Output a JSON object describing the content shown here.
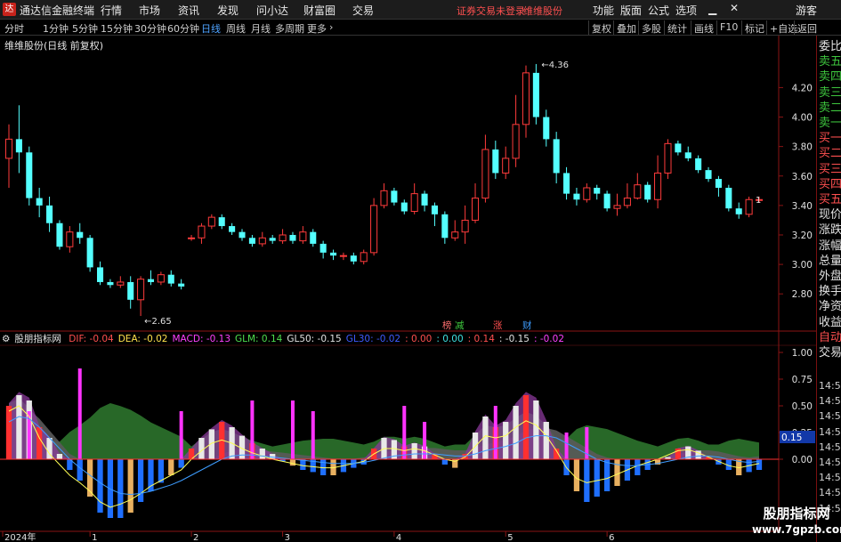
{
  "titlebar": {
    "app_name": "通达信金融终端",
    "menu": [
      "行情",
      "市场",
      "资讯",
      "发现",
      "问小达",
      "财富圈",
      "交易"
    ],
    "status": "证券交易未登录",
    "stock_name": "维维股份",
    "right_menu": [
      "功能",
      "版面",
      "公式",
      "选项"
    ],
    "guest": "游客"
  },
  "periodbar": {
    "items": [
      "分时",
      "1分钟",
      "5分钟",
      "15分钟",
      "30分钟",
      "60分钟",
      "日线",
      "周线",
      "月线",
      "多周期",
      "更多"
    ],
    "active": "日线",
    "right_items": [
      "复权",
      "叠加",
      "多股",
      "统计",
      "画线",
      "F10",
      "标记",
      "+自选",
      "返回"
    ]
  },
  "main_chart": {
    "title": "维维股份(日线 前复权)",
    "high_label": "4.36",
    "low_label": "2.65",
    "last_label": "1",
    "y_labels": [
      "4.20",
      "4.00",
      "3.80",
      "3.60",
      "3.40",
      "3.20",
      "3.00",
      "2.80"
    ],
    "event_tags": [
      "榜",
      "减",
      "涨",
      "财"
    ]
  },
  "indicator": {
    "name": "股朋指标网",
    "items": [
      {
        "text": "DIF: -0.04",
        "color": "#ff4f4f"
      },
      {
        "text": "DEA: -0.02",
        "color": "#ffe14d"
      },
      {
        "text": "MACD: -0.13",
        "color": "#ff40ff"
      },
      {
        "text": "GLM: 0.14",
        "color": "#4ede4e"
      },
      {
        "text": "GL50: -0.15",
        "color": "#e0e0e0"
      },
      {
        "text": "GL30: -0.02",
        "color": "#3e5bff"
      },
      {
        "text": ": 0.00",
        "color": "#ff4f4f"
      },
      {
        "text": ": 0.00",
        "color": "#3ee0e0"
      },
      {
        "text": ": 0.14",
        "color": "#ff4f4f"
      },
      {
        "text": ": -0.15",
        "color": "#e0e0e0"
      },
      {
        "text": ": -0.02",
        "color": "#ff40ff"
      }
    ],
    "y_labels": [
      "1.00",
      "0.75",
      "0.50",
      "0.25",
      "0.00"
    ],
    "current_value": "0.15"
  },
  "x_axis": {
    "labels": [
      "2024年",
      "1",
      "2",
      "3",
      "4",
      "5",
      "6"
    ]
  },
  "side_panel": {
    "items": [
      "委比",
      "卖五",
      "卖四",
      "卖三",
      "卖二",
      "卖一",
      "买一",
      "买二",
      "买三",
      "买四",
      "买五",
      "现价",
      "涨跌",
      "涨幅",
      "总量",
      "外盘",
      "换手",
      "净资",
      "收益",
      "自动",
      "交易"
    ],
    "times": [
      "14:56",
      "14:56",
      "14:56",
      "14:56",
      "14:56",
      "14:56",
      "14:56",
      "14:56",
      "14:56"
    ]
  },
  "watermark": {
    "line1": "股朋指标网",
    "line2": "www.7gpzb.com"
  },
  "chart_data": {
    "type": "candlestick",
    "ylim": [
      2.62,
      4.42
    ],
    "x_month_starts": {
      "1": 8,
      "2": 18,
      "3": 27,
      "4": 38,
      "5": 49,
      "6": 59
    },
    "candles": [
      [
        3.72,
        3.85,
        3.95,
        3.52
      ],
      [
        3.85,
        3.76,
        4.08,
        3.62
      ],
      [
        3.76,
        3.45,
        3.8,
        3.4
      ],
      [
        3.45,
        3.4,
        3.52,
        3.32
      ],
      [
        3.4,
        3.28,
        3.46,
        3.22
      ],
      [
        3.28,
        3.12,
        3.3,
        3.1
      ],
      [
        3.12,
        3.22,
        3.26,
        3.08
      ],
      [
        3.22,
        3.18,
        3.28,
        3.14
      ],
      [
        3.18,
        2.98,
        3.2,
        2.95
      ],
      [
        2.98,
        2.88,
        3.02,
        2.86
      ],
      [
        2.88,
        2.86,
        2.9,
        2.84
      ],
      [
        2.86,
        2.88,
        2.92,
        2.84
      ],
      [
        2.88,
        2.76,
        2.92,
        2.7
      ],
      [
        2.76,
        2.9,
        2.92,
        2.65
      ],
      [
        2.9,
        2.88,
        2.96,
        2.86
      ],
      [
        2.88,
        2.93,
        2.95,
        2.86
      ],
      [
        2.93,
        2.87,
        2.96,
        2.85
      ],
      [
        2.87,
        2.85,
        2.9,
        2.83
      ],
      [
        3.18,
        3.18,
        3.2,
        3.16
      ],
      [
        3.18,
        3.26,
        3.28,
        3.14
      ],
      [
        3.26,
        3.32,
        3.34,
        3.24
      ],
      [
        3.32,
        3.26,
        3.34,
        3.24
      ],
      [
        3.26,
        3.22,
        3.28,
        3.2
      ],
      [
        3.22,
        3.18,
        3.24,
        3.16
      ],
      [
        3.18,
        3.14,
        3.2,
        3.12
      ],
      [
        3.14,
        3.18,
        3.22,
        3.12
      ],
      [
        3.18,
        3.16,
        3.2,
        3.14
      ],
      [
        3.16,
        3.2,
        3.24,
        3.14
      ],
      [
        3.2,
        3.16,
        3.22,
        3.14
      ],
      [
        3.16,
        3.22,
        3.26,
        3.14
      ],
      [
        3.22,
        3.14,
        3.24,
        3.12
      ],
      [
        3.14,
        3.08,
        3.16,
        3.04
      ],
      [
        3.08,
        3.06,
        3.1,
        3.03
      ],
      [
        3.06,
        3.06,
        3.08,
        3.03
      ],
      [
        3.06,
        3.02,
        3.08,
        3.0
      ],
      [
        3.02,
        3.08,
        3.1,
        3.0
      ],
      [
        3.08,
        3.4,
        3.45,
        3.06
      ],
      [
        3.4,
        3.5,
        3.55,
        3.38
      ],
      [
        3.5,
        3.42,
        3.52,
        3.4
      ],
      [
        3.42,
        3.36,
        3.44,
        3.34
      ],
      [
        3.36,
        3.48,
        3.55,
        3.34
      ],
      [
        3.48,
        3.4,
        3.5,
        3.36
      ],
      [
        3.4,
        3.34,
        3.42,
        3.26
      ],
      [
        3.34,
        3.18,
        3.36,
        3.14
      ],
      [
        3.18,
        3.22,
        3.3,
        3.16
      ],
      [
        3.22,
        3.3,
        3.4,
        3.14
      ],
      [
        3.3,
        3.45,
        3.55,
        3.28
      ],
      [
        3.45,
        3.78,
        3.88,
        3.42
      ],
      [
        3.78,
        3.62,
        3.84,
        3.58
      ],
      [
        3.62,
        3.72,
        3.8,
        3.58
      ],
      [
        3.72,
        3.95,
        4.15,
        3.66
      ],
      [
        3.95,
        4.3,
        4.35,
        3.86
      ],
      [
        4.3,
        4.0,
        4.36,
        3.95
      ],
      [
        4.0,
        3.85,
        4.05,
        3.8
      ],
      [
        3.85,
        3.62,
        3.9,
        3.55
      ],
      [
        3.62,
        3.48,
        3.66,
        3.44
      ],
      [
        3.48,
        3.44,
        3.52,
        3.4
      ],
      [
        3.44,
        3.52,
        3.55,
        3.42
      ],
      [
        3.52,
        3.48,
        3.54,
        3.44
      ],
      [
        3.48,
        3.38,
        3.5,
        3.36
      ],
      [
        3.38,
        3.4,
        3.48,
        3.33
      ],
      [
        3.4,
        3.45,
        3.55,
        3.38
      ],
      [
        3.45,
        3.54,
        3.62,
        3.44
      ],
      [
        3.54,
        3.44,
        3.56,
        3.42
      ],
      [
        3.44,
        3.62,
        3.74,
        3.38
      ],
      [
        3.62,
        3.82,
        3.85,
        3.58
      ],
      [
        3.82,
        3.76,
        3.84,
        3.74
      ],
      [
        3.76,
        3.72,
        3.8,
        3.7
      ],
      [
        3.72,
        3.64,
        3.74,
        3.62
      ],
      [
        3.64,
        3.58,
        3.66,
        3.56
      ],
      [
        3.58,
        3.52,
        3.6,
        3.46
      ],
      [
        3.52,
        3.38,
        3.54,
        3.36
      ],
      [
        3.38,
        3.34,
        3.42,
        3.31
      ],
      [
        3.34,
        3.44,
        3.46,
        3.32
      ],
      [
        3.44,
        3.44,
        3.46,
        3.42
      ]
    ],
    "macd": [
      0.5,
      0.6,
      0.55,
      0.3,
      0.2,
      0.05,
      -0.1,
      -0.2,
      -0.35,
      -0.5,
      -0.55,
      -0.55,
      -0.5,
      -0.4,
      -0.3,
      -0.22,
      -0.15,
      -0.08,
      0.1,
      0.2,
      0.28,
      0.35,
      0.3,
      0.22,
      0.15,
      0.1,
      0.05,
      -0.02,
      -0.06,
      -0.1,
      -0.12,
      -0.15,
      -0.15,
      -0.12,
      -0.08,
      -0.05,
      0.1,
      0.2,
      0.18,
      0.12,
      0.15,
      0.12,
      0.05,
      -0.05,
      -0.08,
      0.05,
      0.25,
      0.4,
      0.3,
      0.35,
      0.5,
      0.6,
      0.55,
      0.35,
      0.1,
      -0.15,
      -0.3,
      -0.4,
      -0.35,
      -0.3,
      -0.25,
      -0.2,
      -0.15,
      -0.1,
      -0.05,
      0.02,
      0.1,
      0.12,
      0.08,
      0.02,
      -0.05,
      -0.1,
      -0.15,
      -0.12,
      -0.1
    ],
    "dif": [
      0.45,
      0.5,
      0.4,
      0.2,
      0.05,
      -0.05,
      -0.15,
      -0.22,
      -0.3,
      -0.4,
      -0.45,
      -0.42,
      -0.38,
      -0.32,
      -0.25,
      -0.2,
      -0.15,
      -0.1,
      0.0,
      0.08,
      0.15,
      0.18,
      0.15,
      0.1,
      0.06,
      0.03,
      0.0,
      -0.02,
      -0.04,
      -0.06,
      -0.07,
      -0.08,
      -0.08,
      -0.06,
      -0.04,
      -0.02,
      0.05,
      0.1,
      0.1,
      0.08,
      0.1,
      0.08,
      0.04,
      0.0,
      -0.02,
      0.02,
      0.12,
      0.22,
      0.2,
      0.22,
      0.3,
      0.36,
      0.32,
      0.22,
      0.08,
      -0.08,
      -0.18,
      -0.22,
      -0.2,
      -0.18,
      -0.14,
      -0.1,
      -0.06,
      -0.03,
      0.0,
      0.04,
      0.08,
      0.09,
      0.06,
      0.02,
      -0.02,
      -0.06,
      -0.08,
      -0.06,
      -0.04
    ],
    "dea": [
      0.35,
      0.4,
      0.38,
      0.3,
      0.2,
      0.1,
      0.0,
      -0.08,
      -0.15,
      -0.22,
      -0.28,
      -0.32,
      -0.33,
      -0.32,
      -0.3,
      -0.27,
      -0.24,
      -0.2,
      -0.15,
      -0.1,
      -0.05,
      0.0,
      0.03,
      0.04,
      0.04,
      0.03,
      0.02,
      0.01,
      0.0,
      -0.01,
      -0.02,
      -0.03,
      -0.04,
      -0.04,
      -0.04,
      -0.03,
      -0.01,
      0.01,
      0.03,
      0.04,
      0.05,
      0.05,
      0.05,
      0.04,
      0.03,
      0.03,
      0.05,
      0.08,
      0.1,
      0.12,
      0.15,
      0.2,
      0.22,
      0.22,
      0.2,
      0.15,
      0.1,
      0.05,
      0.0,
      -0.03,
      -0.05,
      -0.06,
      -0.06,
      -0.05,
      -0.04,
      -0.02,
      0.0,
      0.02,
      0.03,
      0.03,
      0.02,
      0.0,
      -0.02,
      -0.03,
      -0.02
    ],
    "spikes": [
      [
        2,
        0.45
      ],
      [
        7,
        0.85
      ],
      [
        17,
        0.45
      ],
      [
        24,
        0.55
      ],
      [
        28,
        0.55
      ],
      [
        30,
        0.45
      ],
      [
        39,
        0.5
      ],
      [
        41,
        0.35
      ],
      [
        48,
        0.5
      ],
      [
        55,
        0.25
      ],
      [
        57,
        0.3
      ]
    ]
  }
}
